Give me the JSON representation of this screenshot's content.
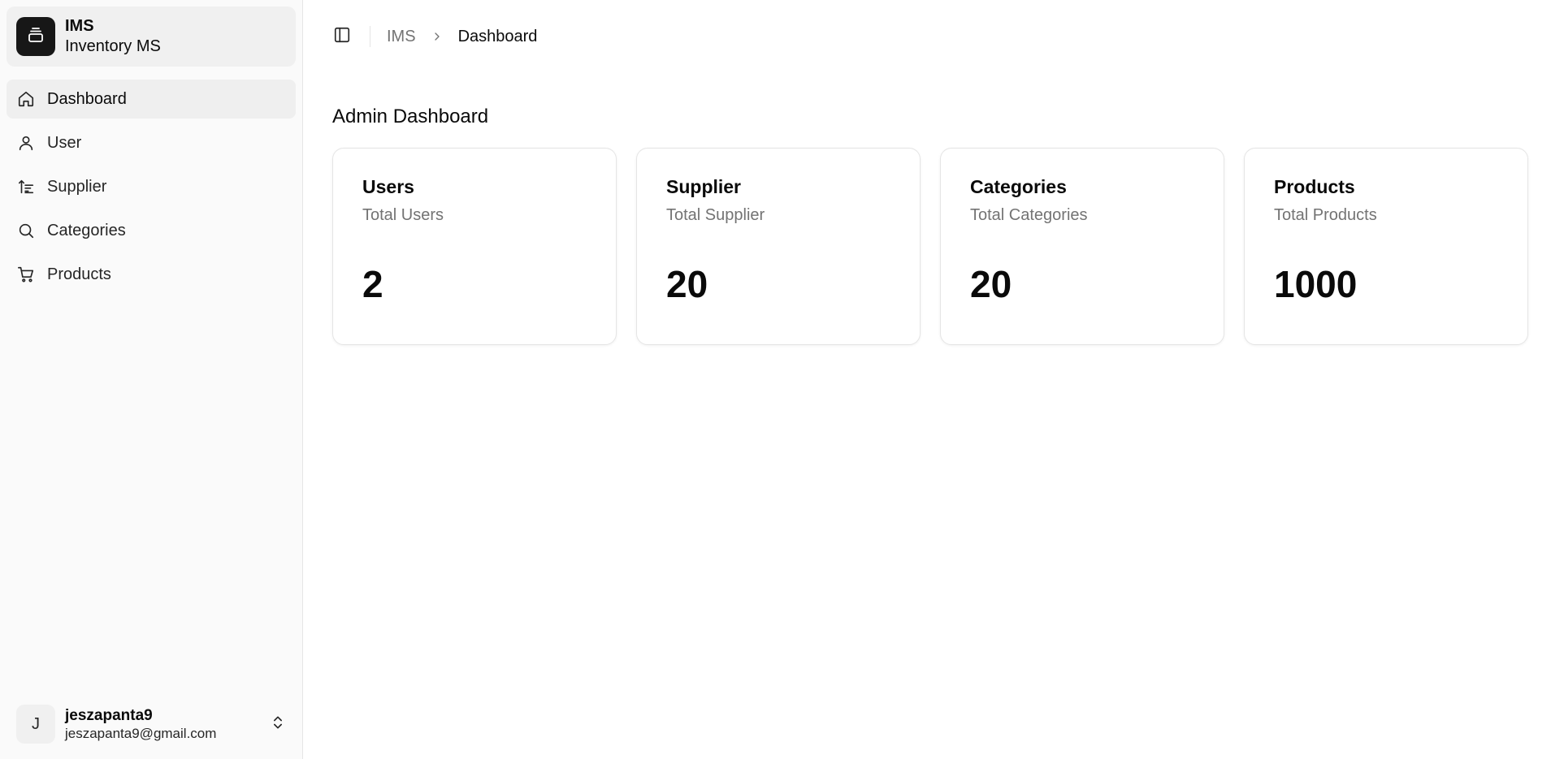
{
  "brand": {
    "title": "IMS",
    "subtitle": "Inventory MS"
  },
  "sidebar": {
    "items": [
      {
        "label": "Dashboard",
        "icon": "home-icon",
        "active": true
      },
      {
        "label": "User",
        "icon": "user-icon",
        "active": false
      },
      {
        "label": "Supplier",
        "icon": "sort-icon",
        "active": false
      },
      {
        "label": "Categories",
        "icon": "search-icon",
        "active": false
      },
      {
        "label": "Products",
        "icon": "cart-icon",
        "active": false
      }
    ]
  },
  "user": {
    "initial": "J",
    "name": "jeszapanta9",
    "email": "jeszapanta9@gmail.com"
  },
  "breadcrumb": {
    "root": "IMS",
    "current": "Dashboard"
  },
  "page": {
    "title": "Admin Dashboard"
  },
  "cards": [
    {
      "title": "Users",
      "description": "Total Users",
      "value": "2"
    },
    {
      "title": "Supplier",
      "description": "Total Supplier",
      "value": "20"
    },
    {
      "title": "Categories",
      "description": "Total Categories",
      "value": "20"
    },
    {
      "title": "Products",
      "description": "Total Products",
      "value": "1000"
    }
  ],
  "colors": {
    "brand_bg": "#171717",
    "sidebar_bg": "#fafafa",
    "active_bg": "#efefef",
    "muted_text": "#737373"
  }
}
